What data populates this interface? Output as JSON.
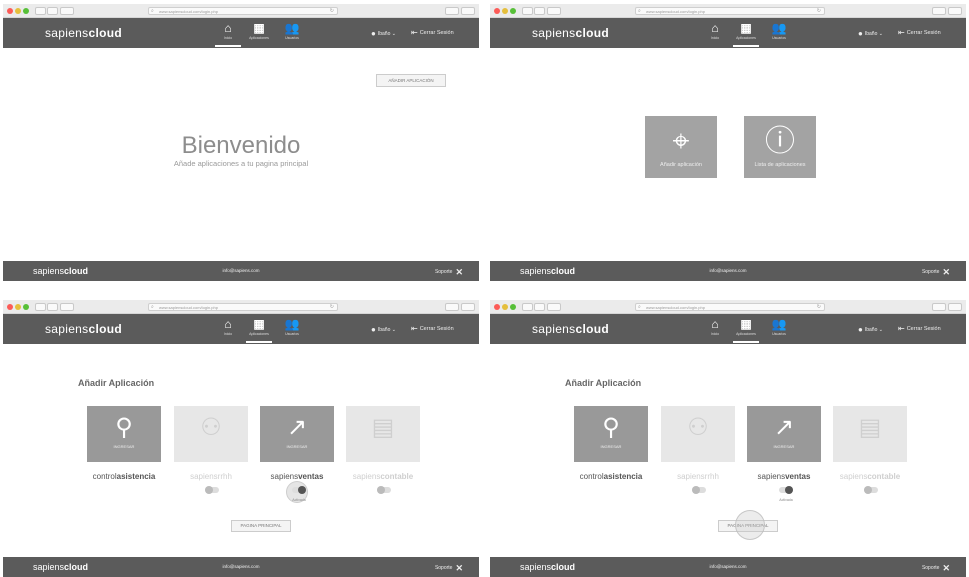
{
  "colors": {
    "nav_bg": "#5b5b5b",
    "tile_bg": "#a3a3a3",
    "app_on": "#999999",
    "app_off": "#e7e7e7"
  },
  "browser": {
    "url": "www.sapienscloud.com/login.php"
  },
  "nav": {
    "logo_light": "sapiens",
    "logo_bold": "cloud",
    "items": [
      {
        "label": "Inicio",
        "icon": "home-icon"
      },
      {
        "label": "Aplicaciones",
        "icon": "apps-grid-icon"
      },
      {
        "label": "Usuarios",
        "icon": "users-icon"
      }
    ],
    "user": "Ibaño",
    "logout": "Cerrar Sesión"
  },
  "footer": {
    "logo_light": "sapiens",
    "logo_bold": "cloud",
    "email": "info@sapiens.com",
    "support": "Soporte"
  },
  "screen1": {
    "add_button": "AÑADIR APLICACIÓN",
    "welcome": "Bienvenido",
    "subtitle": "Añade aplicaciones a tu pagina principal"
  },
  "screen2": {
    "tiles": [
      {
        "label": "Añadir aplicación",
        "icon": "crosshair-plus-icon"
      },
      {
        "label": "Lista de aplicaciones",
        "icon": "info-icon"
      }
    ]
  },
  "apps_screen": {
    "title": "Añadir Aplicación",
    "apps": [
      {
        "name_light": "control",
        "name_bold": "asistencia",
        "badge": "INGRESAR",
        "icon": "location-pin-icon",
        "enabled": true
      },
      {
        "name_light": "sapiensrrhh",
        "name_bold": "",
        "badge": "",
        "icon": "user-search-icon",
        "enabled": false
      },
      {
        "name_light": "sapiens",
        "name_bold": "ventas",
        "badge": "INGRESAR",
        "icon": "sales-chart-icon",
        "enabled": true
      },
      {
        "name_light": "sapiens",
        "name_bold": "contable",
        "badge": "",
        "icon": "accounting-doc-icon",
        "enabled": false
      }
    ],
    "toggle_label": "Activada",
    "home_button": "PAGINA PRINCIPAL"
  }
}
